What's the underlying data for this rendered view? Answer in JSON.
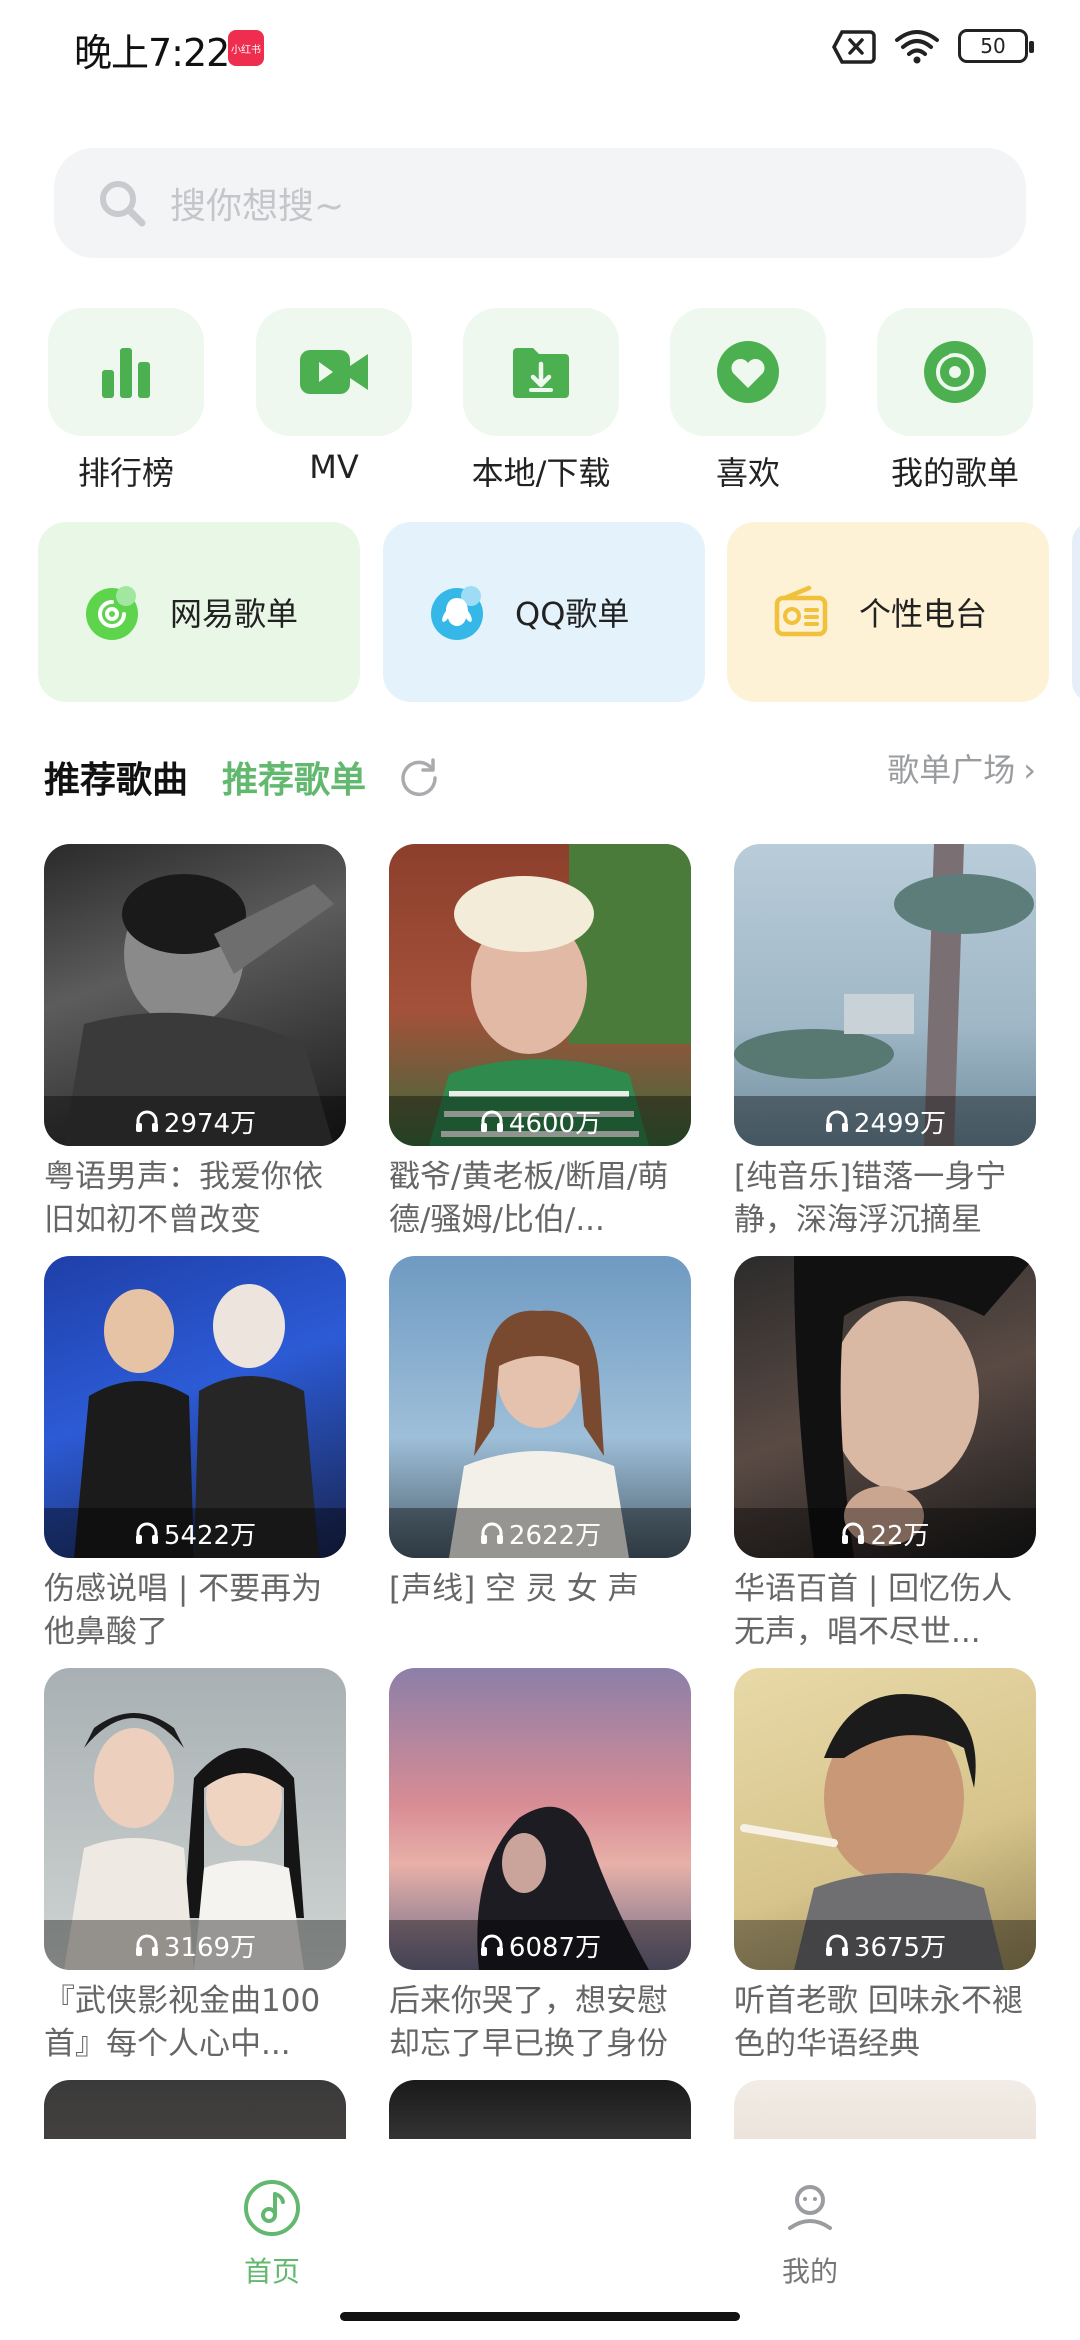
{
  "status_bar": {
    "time": "晚上7:22",
    "badge": "小红书",
    "battery": "50"
  },
  "search": {
    "placeholder": "搜你想搜~"
  },
  "shortcuts": [
    {
      "label": "排行榜",
      "icon": "chart-bars-icon"
    },
    {
      "label": "MV",
      "icon": "video-camera-icon"
    },
    {
      "label": "本地/下载",
      "icon": "download-folder-icon"
    },
    {
      "label": "喜欢",
      "icon": "heart-icon"
    },
    {
      "label": "我的歌单",
      "icon": "disc-icon"
    }
  ],
  "playlist_cards": [
    {
      "label": "网易歌单",
      "icon": "netease-icon",
      "bg": "#e9f8e6"
    },
    {
      "label": "QQ歌单",
      "icon": "qq-penguin-icon",
      "bg": "#e4f3fb"
    },
    {
      "label": "个性电台",
      "icon": "radio-icon",
      "bg": "#fdf1d6"
    }
  ],
  "section": {
    "tab_songs": "推荐歌曲",
    "tab_playlists": "推荐歌单",
    "square_link": "歌单广场"
  },
  "playlists": [
    {
      "plays": "2974万",
      "title": "粤语男声：我爱你依旧如初不曾改变"
    },
    {
      "plays": "4600万",
      "title": "戳爷/黄老板/断眉/萌德/骚姆/比伯/..."
    },
    {
      "plays": "2499万",
      "title": "[纯音乐]错落一身宁静，深海浮沉摘星"
    },
    {
      "plays": "5422万",
      "title": "伤感说唱 | 不要再为他鼻酸了"
    },
    {
      "plays": "2622万",
      "title": "[声线] 空 灵 女 声"
    },
    {
      "plays": "22万",
      "title": "华语百首 | 回忆伤人无声，唱不尽世..."
    },
    {
      "plays": "3169万",
      "title": "『武侠影视金曲100首』每个人心中..."
    },
    {
      "plays": "6087万",
      "title": "后来你哭了，想安慰却忘了早已换了身份"
    },
    {
      "plays": "3675万",
      "title": "听首老歌 回味永不褪色的华语经典"
    }
  ],
  "bottom_nav": {
    "home": "首页",
    "mine": "我的"
  },
  "colors": {
    "accent": "#62b86f",
    "icon_green": "#4caf50"
  }
}
